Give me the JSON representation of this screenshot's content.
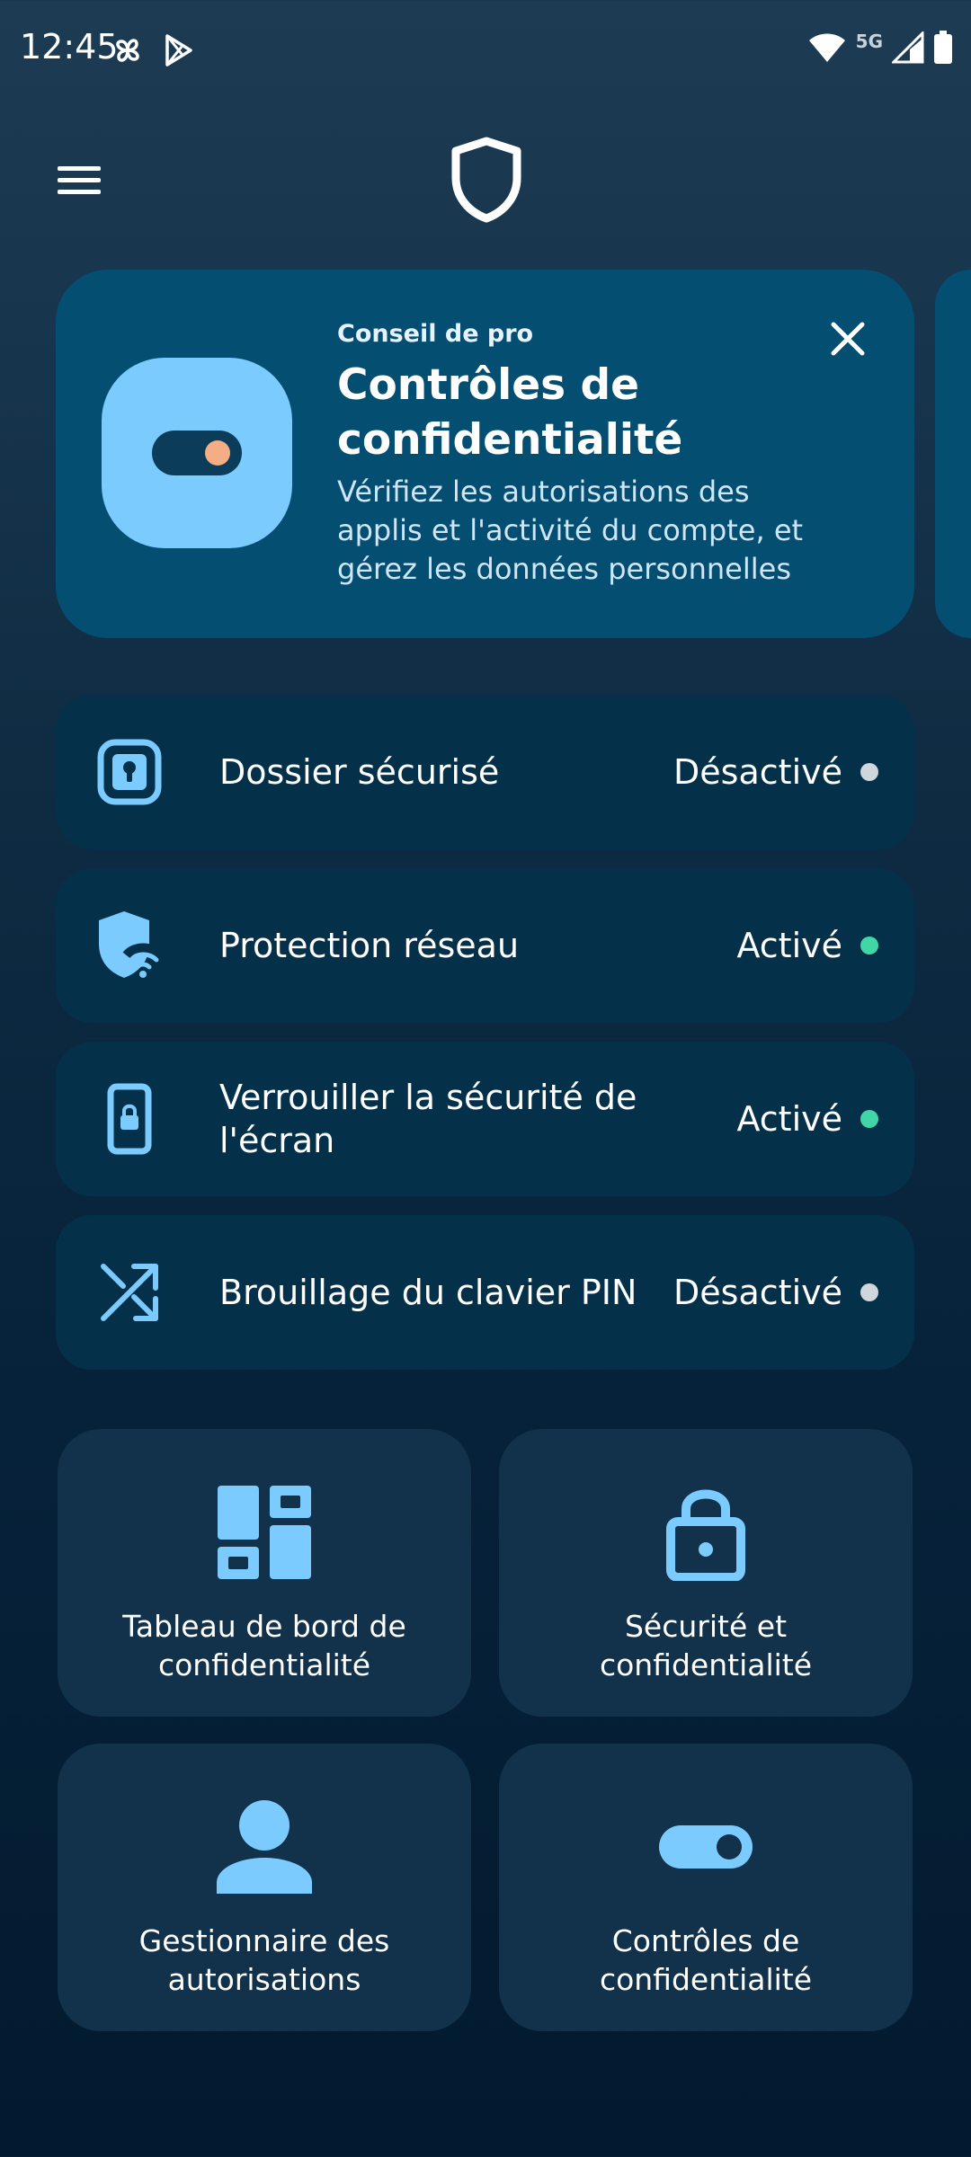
{
  "status_bar": {
    "time": "12:45",
    "network": "5G"
  },
  "colors": {
    "accent": "#7ccbff",
    "card": "#044e71",
    "row": "#053049",
    "tile": "#12324b",
    "status_on": "#41d6a6",
    "status_off": "#cfd6dc"
  },
  "tip": {
    "eyebrow": "Conseil de pro",
    "title": "Contrôles de confidentialité",
    "description": "Vérifiez les autorisations des applis et l'activité du compte, et gérez les données personnelles",
    "icon": "toggle-icon"
  },
  "rows": [
    {
      "label": "Dossier sécurisé",
      "value": "Désactivé",
      "icon": "secure-folder-icon",
      "state": "off"
    },
    {
      "label": "Protection réseau",
      "value": "Activé",
      "icon": "network-shield-icon",
      "state": "on"
    },
    {
      "label": "Verrouiller la sécurité de l'écran",
      "value": "Activé",
      "icon": "phone-lock-icon",
      "state": "on"
    },
    {
      "label": "Brouillage du clavier PIN",
      "value": "Désactivé",
      "icon": "shuffle-icon",
      "state": "off"
    }
  ],
  "tiles": [
    {
      "label": "Tableau de bord de confidentialité",
      "icon": "dashboard-icon"
    },
    {
      "label": "Sécurité et confidentialité",
      "icon": "lock-icon"
    },
    {
      "label": "Gestionnaire des autorisations",
      "icon": "person-icon"
    },
    {
      "label": "Contrôles de confidentialité",
      "icon": "toggle-icon"
    }
  ]
}
